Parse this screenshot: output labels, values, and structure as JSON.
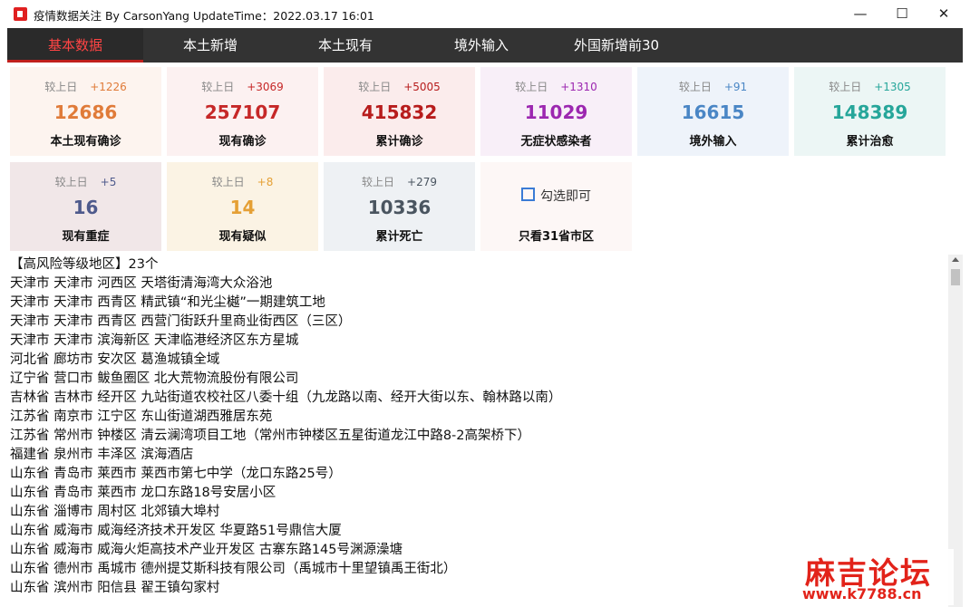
{
  "window": {
    "title": "疫情数据关注 By CarsonYang  UpdateTime：2022.03.17 16:01",
    "min": "—",
    "max": "☐",
    "close": "✕"
  },
  "tabs": [
    "基本数据",
    "本土新增",
    "本土现有",
    "境外输入",
    "外国新增前30"
  ],
  "active_tab": 0,
  "cards": [
    {
      "cmp": "较上日",
      "delta": "+1226",
      "value": "12686",
      "label": "本土现有确诊",
      "color": "#e07b39",
      "delta_color": "#e07b39",
      "bg": "#fdf4ef"
    },
    {
      "cmp": "较上日",
      "delta": "+3069",
      "value": "257107",
      "label": "现有确诊",
      "color": "#c62828",
      "delta_color": "#c62828",
      "bg": "#fcf1f1"
    },
    {
      "cmp": "较上日",
      "delta": "+5005",
      "value": "415832",
      "label": "累计确诊",
      "color": "#b71c1c",
      "delta_color": "#b71c1c",
      "bg": "#fbecec"
    },
    {
      "cmp": "较上日",
      "delta": "+1310",
      "value": "11029",
      "label": "无症状感染者",
      "color": "#9c27b0",
      "delta_color": "#9c27b0",
      "bg": "#f8eff8"
    },
    {
      "cmp": "较上日",
      "delta": "+91",
      "value": "16615",
      "label": "境外输入",
      "color": "#4a86c5",
      "delta_color": "#4a86c5",
      "bg": "#eef3fa"
    },
    {
      "cmp": "较上日",
      "delta": "+1305",
      "value": "148389",
      "label": "累计治愈",
      "color": "#26a69a",
      "delta_color": "#26a69a",
      "bg": "#ecf6f5"
    },
    {
      "cmp": "较上日",
      "delta": "+5",
      "value": "16",
      "label": "现有重症",
      "color": "#4e5a8c",
      "delta_color": "#4e5a8c",
      "bg": "#f1e7e8"
    },
    {
      "cmp": "较上日",
      "delta": "+8",
      "value": "14",
      "label": "现有疑似",
      "color": "#e5a035",
      "delta_color": "#e5a035",
      "bg": "#fbf3e4"
    },
    {
      "cmp": "较上日",
      "delta": "+279",
      "value": "10336",
      "label": "累计死亡",
      "color": "#4a5560",
      "delta_color": "#4a5560",
      "bg": "#eef1f4"
    }
  ],
  "filter_card": {
    "check_label": "勾选即可",
    "label": "只看31省市区",
    "checked": false,
    "bg": "#fdf7f6"
  },
  "list": {
    "lines": [
      "【高风险等级地区】23个",
      "天津市 天津市 河西区 天塔街清海湾大众浴池",
      "天津市 天津市 西青区 精武镇“和光尘樾”一期建筑工地",
      "天津市 天津市 西青区 西营门街跃升里商业街西区（三区）",
      "天津市 天津市 滨海新区 天津临港经济区东方星城",
      "河北省 廊坊市 安次区 葛渔城镇全域",
      "辽宁省 营口市 鲅鱼圈区 北大荒物流股份有限公司",
      "吉林省 吉林市 经开区 九站街道农校社区八委十组（九龙路以南、经开大街以东、翰林路以南）",
      "江苏省 南京市 江宁区 东山街道湖西雅居东苑",
      "江苏省 常州市 钟楼区 清云澜湾项目工地（常州市钟楼区五星街道龙江中路8-2高架桥下）",
      "福建省 泉州市 丰泽区 滨海酒店",
      "山东省 青岛市 莱西市 莱西市第七中学（龙口东路25号）",
      "山东省 青岛市 莱西市 龙口东路18号安居小区",
      "山东省 淄博市 周村区 北郊镇大埠村",
      "山东省 威海市 威海经济技术开发区 华夏路51号鼎信大厦",
      "山东省 威海市 威海火炬高技术产业开发区 古寨东路145号渊源澡塘",
      "山东省 德州市 禹城市 德州提艾斯科技有限公司（禹城市十里望镇禹王街北）",
      "山东省 滨州市 阳信县 翟王镇勾家村"
    ]
  },
  "watermark": {
    "title": "麻吉论坛",
    "url": "www.k7788.cn"
  }
}
